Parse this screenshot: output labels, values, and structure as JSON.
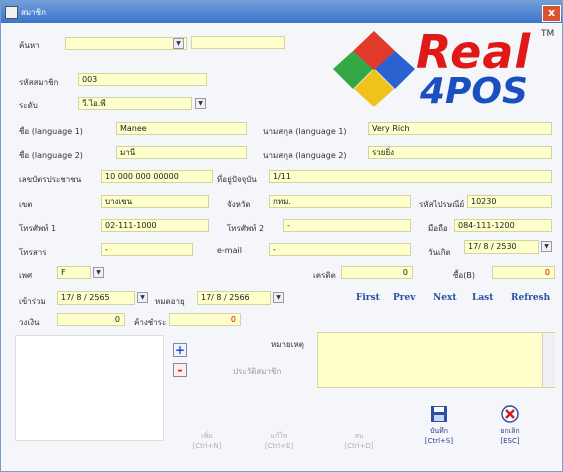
{
  "window": {
    "title": "สมาชิก",
    "close_label": "x"
  },
  "logo": {
    "real": "Real",
    "pos": "4POS",
    "tm": "TM"
  },
  "search": {
    "label": "ค้นหา",
    "value": "",
    "value2": ""
  },
  "member_code": {
    "label": "รหัสสมาชิก",
    "value": "003"
  },
  "level": {
    "label": "ระดับ",
    "value": "วี.ไอ.พี"
  },
  "name1": {
    "label": "ชื่อ (language 1)",
    "value": "Manee"
  },
  "surname1": {
    "label": "นามสกุล (language 1)",
    "value": "Very Rich"
  },
  "name2": {
    "label": "ชื่อ (language 2)",
    "value": "มานี"
  },
  "surname2": {
    "label": "นามสกุล (language 2)",
    "value": "รวยยิ่ง"
  },
  "id_card": {
    "label": "เลขบัตรประชาชน",
    "value": "10 000 000 00000"
  },
  "address": {
    "label": "ที่อยู่ปัจจุบัน",
    "value": "1/11"
  },
  "district": {
    "label": "เขต",
    "value": "บางเขน"
  },
  "province": {
    "label": "จังหวัด",
    "value": "กทม."
  },
  "postcode": {
    "label": "รหัสไปรษณีย์",
    "value": "10230"
  },
  "phone1": {
    "label": "โทรศัพท์ 1",
    "value": "02-111-1000"
  },
  "phone2": {
    "label": "โทรศัพท์ 2",
    "value": "-"
  },
  "mobile": {
    "label": "มือถือ",
    "value": "084-111-1200"
  },
  "fax": {
    "label": "โทรสาร",
    "value": "-"
  },
  "email": {
    "label": "e-mail",
    "value": "-"
  },
  "birthday": {
    "label": "วันเกิด",
    "value": "17/ 8 / 2530"
  },
  "gender": {
    "label": "เพศ",
    "value": "F"
  },
  "credit": {
    "label": "เครดิต",
    "value": "0"
  },
  "points": {
    "label": "ซื้อ(B)",
    "value": "0"
  },
  "join_date": {
    "label": "เข้าร่วม",
    "value": "17/ 8 / 2565"
  },
  "expire_date": {
    "label": "หมดอายุ",
    "value": "17/ 8 / 2566"
  },
  "nav": {
    "first": "First",
    "prev": "Prev",
    "next": "Next",
    "last": "Last",
    "refresh": "Refresh"
  },
  "deposit": {
    "label": "วงเงิน",
    "value": "0"
  },
  "outstanding": {
    "label": "ค้างชำระ",
    "value": "0"
  },
  "note": {
    "label": "หมายเหตุ",
    "value": ""
  },
  "history_label": "ประวัติสมาชิก",
  "panel_buttons": {
    "add": "+",
    "remove": "-"
  },
  "actions": {
    "add": {
      "label": "เพิ่ม",
      "key": "[Ctrl+N]"
    },
    "edit": {
      "label": "แก้ไข",
      "key": "[Ctrl+E]"
    },
    "delete": {
      "label": "ลบ",
      "key": "[Ctrl+D]"
    },
    "save": {
      "label": "บันทึก",
      "key": "[Ctrl+S]"
    },
    "cancel": {
      "label": "ยกเลิก",
      "key": "[ESC]"
    }
  },
  "colors": {
    "field_bg": "#ffffcc",
    "nav": "#274f9e",
    "logo_real": "#e01818",
    "logo_pos": "#1a4fc0"
  }
}
